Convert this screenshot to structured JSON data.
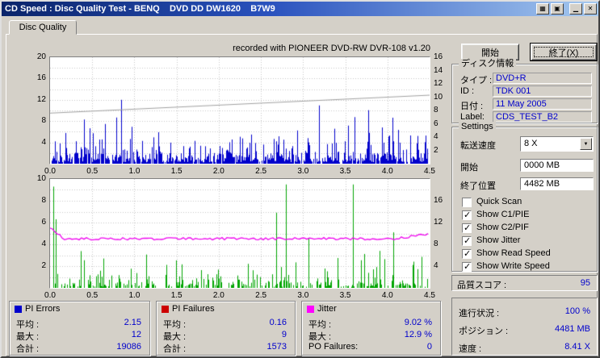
{
  "titlebar": {
    "title": "CD Speed : Disc Quality Test - BENQ    DVD DD DW1620    B7W9",
    "buttons": [
      {
        "name": "keyboard-icon",
        "glyph": "▦"
      },
      {
        "name": "monitor-icon",
        "glyph": "▣"
      },
      {
        "name": "minimize-icon",
        "glyph": "▁"
      },
      {
        "name": "close-icon",
        "glyph": "✕"
      }
    ]
  },
  "tab_label": "Disc Quality",
  "chart_note": "recorded with PIONEER DVD-RW  DVR-108  v1.20",
  "actions": {
    "start": "開始",
    "exit": "終了(X)"
  },
  "disc_info": {
    "title": "ディスク情報",
    "rows": [
      {
        "label": "タイプ :",
        "value": "DVD+R"
      },
      {
        "label": "ID :",
        "value": "TDK 001"
      },
      {
        "label": "日付 :",
        "value": "11 May 2005"
      },
      {
        "label": "Label:",
        "value": "CDS_TEST_B2"
      }
    ]
  },
  "settings": {
    "title": "Settings",
    "fields": [
      {
        "label": "転送速度",
        "value": "8 X",
        "type": "combo"
      },
      {
        "label": "開始",
        "value": "0000 MB",
        "type": "text"
      },
      {
        "label": "終了位置",
        "value": "4482 MB",
        "type": "text"
      }
    ],
    "checkboxes": [
      {
        "label": "Quick Scan",
        "checked": false
      },
      {
        "label": "Show C1/PIE",
        "checked": true
      },
      {
        "label": "Show C2/PIF",
        "checked": true
      },
      {
        "label": "Show Jitter",
        "checked": true
      },
      {
        "label": "Show Read Speed",
        "checked": true
      },
      {
        "label": "Show Write Speed",
        "checked": true
      }
    ]
  },
  "quality": {
    "label": "品質スコア :",
    "value": "95"
  },
  "progress": {
    "rows": [
      {
        "label": "進行状況 :",
        "value": "100 %"
      },
      {
        "label": "ポジション :",
        "value": "4481 MB"
      },
      {
        "label": "速度 :",
        "value": "8.41 X"
      }
    ]
  },
  "legend": [
    {
      "title": "PI Errors",
      "color": "#0000cc",
      "rows": [
        {
          "label": "平均 :",
          "value": "2.15"
        },
        {
          "label": "最大 :",
          "value": "12"
        },
        {
          "label": "合計 :",
          "value": "19086"
        }
      ]
    },
    {
      "title": "PI Failures",
      "color": "#cc0000",
      "rows": [
        {
          "label": "平均 :",
          "value": "0.16"
        },
        {
          "label": "最大 :",
          "value": "9"
        },
        {
          "label": "合計 :",
          "value": "1573"
        }
      ]
    },
    {
      "title": "Jitter",
      "color": "#ff00ff",
      "rows": [
        {
          "label": "平均 :",
          "value": "9.02 %"
        },
        {
          "label": "最大 :",
          "value": "12.9 %"
        },
        {
          "label": "PO Failures:",
          "value": "0"
        }
      ]
    }
  ],
  "chart_data": [
    {
      "type": "bar",
      "title": "PI Errors vs disc position",
      "x_unit": "GB",
      "x_range": [
        0,
        4.5
      ],
      "x_ticks": [
        "0.0",
        "0.5",
        "1.0",
        "1.5",
        "2.0",
        "2.5",
        "3.0",
        "3.5",
        "4.0",
        "4.5"
      ],
      "y_left": {
        "max": 20,
        "ticks": [
          4,
          8,
          12,
          16,
          20
        ]
      },
      "y_right": {
        "max": 16,
        "ticks": [
          2,
          4,
          6,
          8,
          10,
          12,
          14,
          16
        ]
      },
      "grid": true,
      "series": [
        {
          "name": "PI Errors",
          "color": "#0000cc",
          "avg": 2.15,
          "max": 12,
          "total": 19086
        },
        {
          "name": "Read Speed",
          "color": "#a0a0a0",
          "axis": "right",
          "start": 7.6,
          "end": 10.3
        }
      ]
    },
    {
      "type": "bar+line",
      "title": "PI Failures / Jitter vs disc position",
      "x_unit": "GB",
      "x_range": [
        0,
        4.5
      ],
      "x_ticks": [
        "0.0",
        "0.5",
        "1.0",
        "1.5",
        "2.0",
        "2.5",
        "3.0",
        "3.5",
        "4.0",
        "4.5"
      ],
      "y_left": {
        "max": 10,
        "ticks": [
          2,
          4,
          6,
          8,
          10
        ]
      },
      "y_right": {
        "max": 20,
        "ticks": [
          4,
          8,
          12,
          16
        ]
      },
      "grid": true,
      "series": [
        {
          "name": "PI Failures",
          "color": "#00a400",
          "avg": 0.16,
          "max": 9,
          "total": 1573
        },
        {
          "name": "Jitter",
          "color": "#ee00ee",
          "axis": "right",
          "avg": 9.02,
          "max": 12.9,
          "unit": "%"
        }
      ]
    }
  ]
}
